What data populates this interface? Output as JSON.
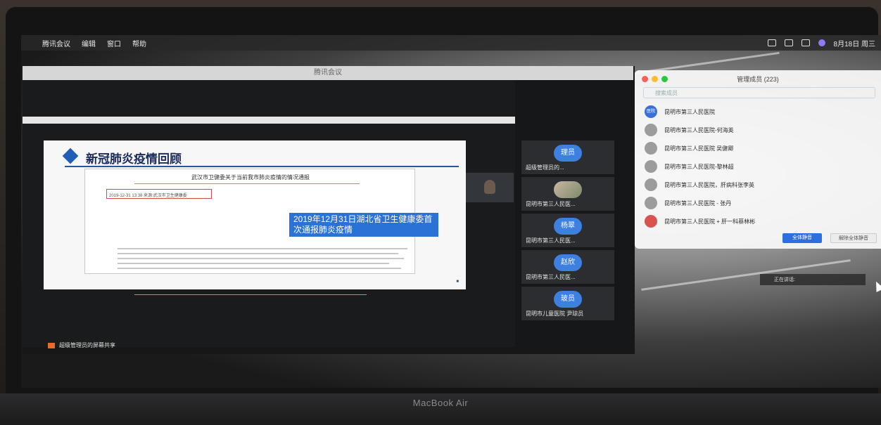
{
  "device_label": "MacBook Air",
  "menubar": {
    "app_name": "腾讯会议",
    "items": [
      "编辑",
      "窗口",
      "帮助"
    ],
    "date": "8月18日 周三"
  },
  "meeting": {
    "window_title": "腾讯会议",
    "sharing_label": "超级管理员的屏幕共享"
  },
  "slide": {
    "title": "新冠肺炎疫情回顾",
    "doc_header": "武汉市卫健委关于当前我市肺炎疫情的情况通报",
    "doc_meta": "2019-12-31 13:38  来源:武汉市卫生健康委",
    "callout": "2019年12月31日湖北省卫生健康委首次通报肺炎疫情"
  },
  "participants": [
    {
      "avatar": "理员",
      "name": "超级管理员的..."
    },
    {
      "avatar": "",
      "name": "昆明市第三人民医..."
    },
    {
      "avatar": "杨翠",
      "name": "昆明市第三人民医..."
    },
    {
      "avatar": "赵欣",
      "name": "昆明市第三人民医..."
    },
    {
      "avatar": "玻员",
      "name": "昆明市儿童医院 尹琼员"
    }
  ],
  "members_panel": {
    "title": "管理成员 (223)",
    "search_placeholder": "搜索成员",
    "members": [
      {
        "avatar": "医院",
        "name": "昆明市第三人民医院"
      },
      {
        "avatar": "",
        "name": "昆明市第三人民医院-何海英"
      },
      {
        "avatar": "",
        "name": "昆明市第三人民医院 吴健卿"
      },
      {
        "avatar": "",
        "name": "昆明市第三人民医院-黎林超"
      },
      {
        "avatar": "",
        "name": "昆明市第三人民医院，肝病科张李英"
      },
      {
        "avatar": "",
        "name": "昆明市第三人民医院 - 张丹"
      },
      {
        "avatar": "",
        "name": "昆明市第三人民医院 + 肝一科蔡林彬"
      }
    ],
    "mute_all": "全体静音",
    "unmute_all": "解除全体静音"
  },
  "speaking_label": "正在讲话:",
  "colors": {
    "accent": "#2e6fe0",
    "slide_title": "#1b2b5c"
  }
}
